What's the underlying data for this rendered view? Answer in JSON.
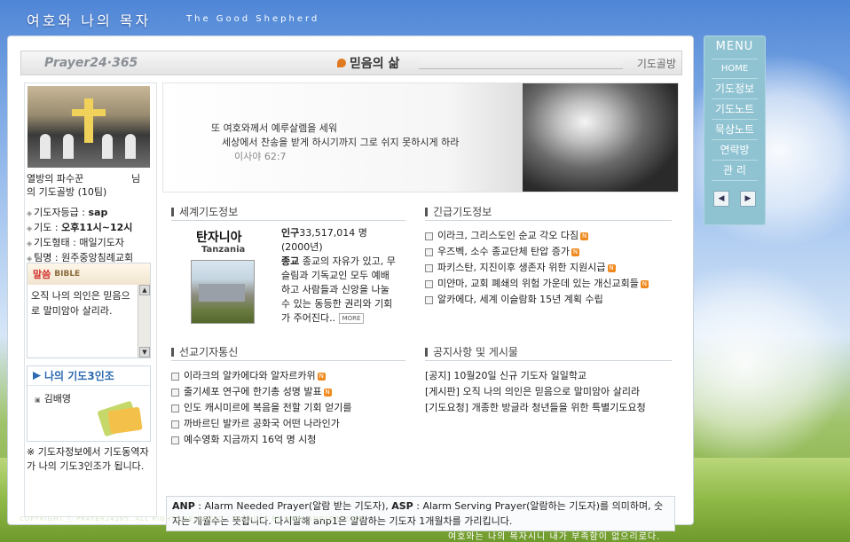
{
  "header": {
    "site_title": "여호와 나의 목자",
    "site_subtitle": "The Good Shepherd"
  },
  "topbar": {
    "logo": "Prayer24·365",
    "section_title": "믿음의 삶",
    "right_label": "기도골방"
  },
  "profile": {
    "name_line1": "열방의 파수꾼",
    "name_suffix": "님",
    "name_line2": "의 기도골방 (10팀)",
    "info": [
      {
        "label": "기도자등급 : ",
        "value": "sap"
      },
      {
        "label": "기도 : ",
        "value": "오후11시~12시"
      },
      {
        "label": "기도형태 : ",
        "value": "매일기도자"
      },
      {
        "label": "팀명 : ",
        "value": "원주중앙침례교회"
      }
    ]
  },
  "bible": {
    "title": "말씀",
    "title_en": "BIBLE",
    "text": "오직 나의 의인은 믿음으로 말미암아 살리라."
  },
  "my3": {
    "title": "나의 기도3인조",
    "member": "김배영"
  },
  "note": "※ 기도자정보에서 기도동역자가 나의 기도3인조가 됩니다.",
  "banner": {
    "verse1": "또 여호와께서 예루살렘을 세워",
    "verse2": "세상에서 찬송을 받게 하시기까지 그로 쉬지 못하시게 하라",
    "ref": "이사야 62:7"
  },
  "world": {
    "heading": "세계기도정보",
    "country_name": "탄자니아",
    "country_en": "Tanzania",
    "population_label": "인구",
    "population_value": "33,517,014 명 (2000년)",
    "religion_label": "종교",
    "religion_text": " 종교의 자유가 있고, 무슬림과 기독교인 모두 예배하고 사람들과 신앙을 나눌 수 있는 동등한 권리와 기회가 주어진다..",
    "more": "MORE"
  },
  "urgent": {
    "heading": "긴급기도정보",
    "items": [
      {
        "text": "이라크, 그리스도인 순교 각오 다짐"
      },
      {
        "text": "우즈벡, 소수 종교단체 탄압 증가"
      },
      {
        "text": "파키스탄, 지진이후 생존자 위한 지원시급"
      },
      {
        "text": "미얀마, 교회 폐쇄의 위험 가운데 있는 개신교회들"
      },
      {
        "text": "알카에다, 세계 이슬람화 15년 계획 수립"
      }
    ],
    "badge": "N"
  },
  "mission": {
    "heading": "선교기자통신",
    "items": [
      {
        "text": "이라크의 알카에다와 알자르카위"
      },
      {
        "text": "줄기세포 연구에 한기총 성명 발표"
      },
      {
        "text": "인도 캐시미르에 복음을 전할 기회 얻기를"
      },
      {
        "text": "까바르딘 발카르 공화국 어떤 나라인가"
      },
      {
        "text": "예수영화 지금까지 16억 명 시청"
      }
    ],
    "badge": "N"
  },
  "notice": {
    "heading": "공지사항 및 게시물",
    "items": [
      {
        "tag": "[공지]",
        "text": "10월20일 신규 기도자 일일학교"
      },
      {
        "tag": "[게시판]",
        "text": "오직 나의 의인은 믿음으로 말미암아 살리라"
      },
      {
        "tag": "[기도요청]",
        "text": "개종한 방글라 청년들을 위한 특별기도요청"
      }
    ]
  },
  "anp": {
    "anp_label": "ANP",
    "anp_text": " : Alarm Needed Prayer(알람 받는 기도자), ",
    "asp_label": "ASP",
    "asp_text": " : Alarm Serving Prayer(알람하는 기도자)를 의미하며, 숫자는 개월수는 뜻합니다. 다시말해 anp1은 알람하는 기도자 1개월차를 가리킵니다."
  },
  "footer": {
    "copyright": "COPYRIGHT ⓒ PRAYER24365. ALL RIGHTS RESERVED  / PRODUCT BY WWW.GMGLORY.COM",
    "motto": "여호와는 나의 목자시니 내가 부족함이 없으리로다."
  },
  "menu": {
    "title": "MENU",
    "items": [
      "HOME",
      "기도정보",
      "기도노트",
      "묵상노트",
      "연락방",
      "관 리"
    ],
    "prev": "◀",
    "next": "▶"
  },
  "colors": {
    "accent_blue": "#2d6ab0",
    "badge_orange": "#f08a1e",
    "menu_bg": "#8fc3d2"
  }
}
